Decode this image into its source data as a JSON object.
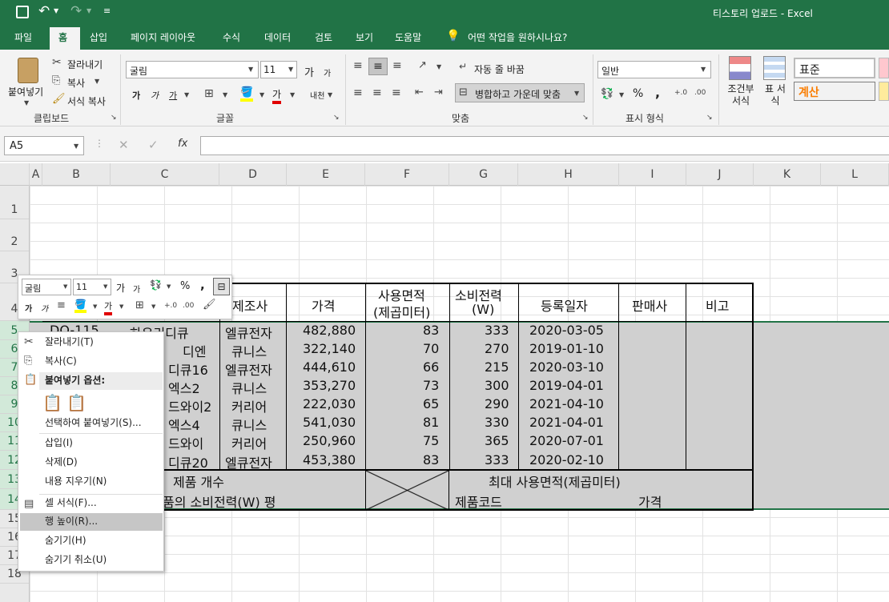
{
  "window": {
    "title": "티스토리 업로드 - Excel"
  },
  "tabs": [
    "파일",
    "홈",
    "삽입",
    "페이지 레이아웃",
    "수식",
    "데이터",
    "검토",
    "보기",
    "도움말"
  ],
  "tell_me": "어떤 작업을 원하시나요?",
  "ribbon": {
    "clipboard": {
      "paste": "붙여넣기",
      "cut": "잘라내기",
      "copy": "복사",
      "format_painter": "서식 복사",
      "group": "클립보드"
    },
    "font": {
      "name": "굴림",
      "size": "11",
      "group": "글꼴",
      "bold": "가",
      "italic": "가",
      "underline": "가",
      "grow": "가",
      "shrink": "가",
      "font_color_glyph": "가",
      "phonetic": "내천"
    },
    "alignment": {
      "wrap": "자동 줄 바꿈",
      "merge": "병합하고 가운데 맞춤",
      "group": "맞춤"
    },
    "number": {
      "format": "일반",
      "percent": "%",
      "comma": ",",
      "group": "표시 형식"
    },
    "styles": {
      "conditional": "조건부 서식",
      "table": "표 서식",
      "normal": "표준",
      "calc": "계산"
    }
  },
  "formula_bar": {
    "name_box": "A5",
    "fx": "fx"
  },
  "columns": [
    "A",
    "B",
    "C",
    "D",
    "E",
    "F",
    "G",
    "H",
    "I",
    "J",
    "K",
    "L"
  ],
  "rows": [
    "1",
    "2",
    "3",
    "4",
    "5",
    "6",
    "7",
    "8",
    "9",
    "10",
    "11",
    "12",
    "13",
    "14",
    "15",
    "16",
    "17",
    "18"
  ],
  "table": {
    "headers": {
      "maker": "제조사",
      "price": "가격",
      "area": "사용면적",
      "area2": "(제곱미터)",
      "power": "소비전력",
      "power2": "(W)",
      "date": "등록일자",
      "seller": "판매사",
      "note": "비고"
    },
    "rows": [
      {
        "code": "DQ-115",
        "name": "하우리디큐",
        "maker": "엘큐전자",
        "price": "482,880",
        "area": "83",
        "power": "333",
        "date": "2020-03-05"
      },
      {
        "code": "",
        "name": "디엔",
        "maker": "큐니스",
        "price": "322,140",
        "area": "70",
        "power": "270",
        "date": "2019-01-10"
      },
      {
        "code": "",
        "name": "디큐16",
        "maker": "엘큐전자",
        "price": "444,610",
        "area": "66",
        "power": "215",
        "date": "2020-03-10"
      },
      {
        "code": "",
        "name": "엑스2",
        "maker": "큐니스",
        "price": "353,270",
        "area": "73",
        "power": "300",
        "date": "2019-04-01"
      },
      {
        "code": "",
        "name": "드와이2",
        "maker": "커리어",
        "price": "222,030",
        "area": "65",
        "power": "290",
        "date": "2021-04-10"
      },
      {
        "code": "",
        "name": "엑스4",
        "maker": "큐니스",
        "price": "541,030",
        "area": "81",
        "power": "330",
        "date": "2021-04-01"
      },
      {
        "code": "",
        "name": "드와이",
        "maker": "커리어",
        "price": "250,960",
        "area": "75",
        "power": "365",
        "date": "2020-07-01"
      },
      {
        "code": "",
        "name": "디큐20",
        "maker": "엘큐전자",
        "price": "453,380",
        "area": "83",
        "power": "333",
        "date": "2020-02-10"
      }
    ],
    "summary1": "제품 개수",
    "summary2": "품의 소비전력(W) 평",
    "max_area": "최대 사용면적(제곱미터)",
    "product_code": "제품코드",
    "price_label": "가격"
  },
  "mini_toolbar": {
    "font": "굴림",
    "size": "11",
    "percent": "%",
    "comma": ","
  },
  "context_menu": {
    "items": [
      {
        "label": "잘라내기(T)",
        "icon": "scissors-icon"
      },
      {
        "label": "복사(C)",
        "icon": "copy-icon"
      },
      {
        "label": "붙여넣기 옵션:",
        "icon": "clipboard-icon"
      },
      {
        "label": "선택하여 붙여넣기(S)...",
        "icon": ""
      },
      {
        "label": "삽입(I)",
        "icon": ""
      },
      {
        "label": "삭제(D)",
        "icon": ""
      },
      {
        "label": "내용 지우기(N)",
        "icon": ""
      },
      {
        "label": "셀 서식(F)...",
        "icon": "format-cells-icon"
      },
      {
        "label": "행 높이(R)...",
        "icon": ""
      },
      {
        "label": "숨기기(H)",
        "icon": ""
      },
      {
        "label": "숨기기 취소(U)",
        "icon": ""
      }
    ]
  },
  "colors": {
    "accent": "#217346",
    "selection": "#d2d2d2",
    "font_red": "#c00000"
  }
}
